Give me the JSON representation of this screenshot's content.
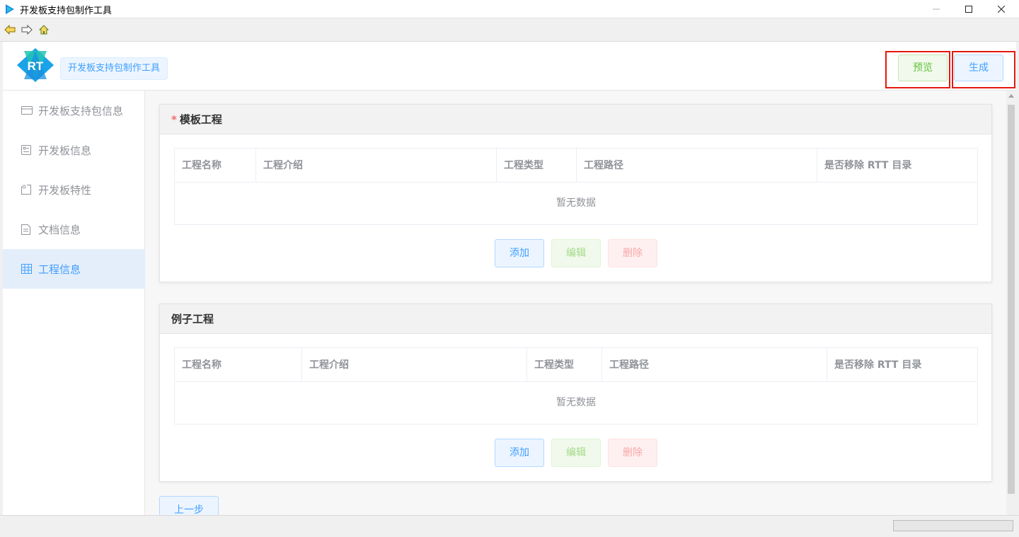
{
  "window": {
    "title": "开发板支持包制作工具"
  },
  "header": {
    "app_tag": "开发板支持包制作工具",
    "preview_label": "预览",
    "generate_label": "生成",
    "logo_text": "RT"
  },
  "sidebar": {
    "items": [
      {
        "label": "开发板支持包信息",
        "icon": "card-icon"
      },
      {
        "label": "开发板信息",
        "icon": "board-icon"
      },
      {
        "label": "开发板特性",
        "icon": "feature-icon"
      },
      {
        "label": "文档信息",
        "icon": "document-icon"
      },
      {
        "label": "工程信息",
        "icon": "grid-icon",
        "active": true
      }
    ]
  },
  "template_project": {
    "required_mark": "*",
    "title": "模板工程",
    "columns": [
      "工程名称",
      "工程介绍",
      "工程类型",
      "工程路径",
      "是否移除 RTT 目录"
    ],
    "empty_text": "暂无数据",
    "add_label": "添加",
    "edit_label": "编辑",
    "delete_label": "删除"
  },
  "example_project": {
    "title": "例子工程",
    "columns": [
      "工程名称",
      "工程介绍",
      "工程类型",
      "工程路径",
      "是否移除 RTT 目录"
    ],
    "empty_text": "暂无数据",
    "add_label": "添加",
    "edit_label": "编辑",
    "delete_label": "删除"
  },
  "footer": {
    "prev_label": "上一步"
  },
  "colors": {
    "primary": "#409eff",
    "success": "#67c23a",
    "danger": "#f56c6c",
    "highlight": "#e5180c"
  }
}
